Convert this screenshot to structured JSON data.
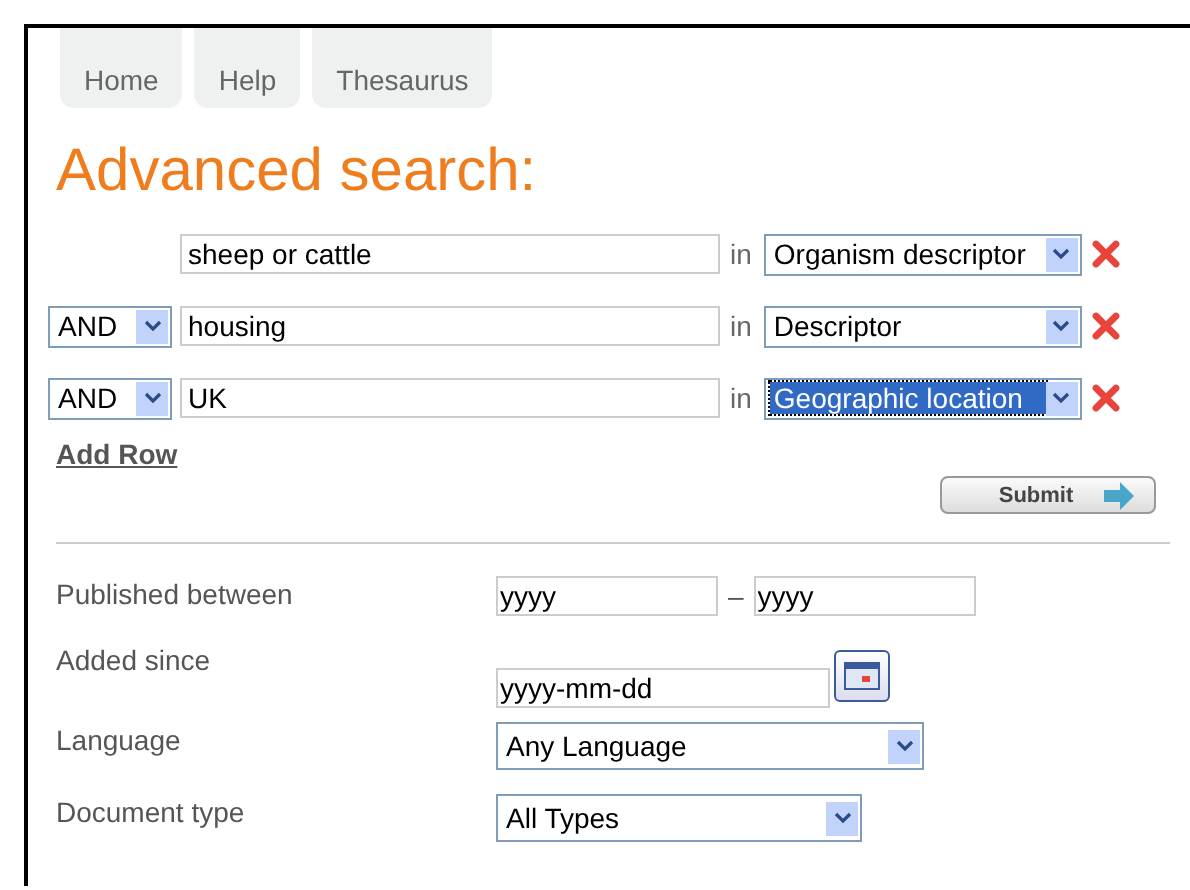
{
  "tabs": [
    {
      "label": "Home"
    },
    {
      "label": "Help"
    },
    {
      "label": "Thesaurus"
    }
  ],
  "title": "Advanced search:",
  "rows": [
    {
      "term": "sheep or cattle",
      "in": "in",
      "field": "Organism descriptor",
      "field_selected": false
    },
    {
      "operator": "AND",
      "term": "housing",
      "in": "in",
      "field": "Descriptor",
      "field_selected": false
    },
    {
      "operator": "AND",
      "term": "UK",
      "in": "in",
      "field": "Geographic location",
      "field_selected": true
    }
  ],
  "add_row": "Add Row",
  "submit": "Submit",
  "filters": [
    {
      "kind": "range",
      "label": "Published between",
      "from": "yyyy",
      "separator": "–",
      "to": "yyyy"
    },
    {
      "kind": "date",
      "label": "Added since",
      "value": "yyyy-mm-dd"
    },
    {
      "kind": "select",
      "label": "Language",
      "value": "Any Language",
      "wide": true
    },
    {
      "kind": "select",
      "label": "Document type",
      "value": "All Types",
      "wide": false
    }
  ]
}
